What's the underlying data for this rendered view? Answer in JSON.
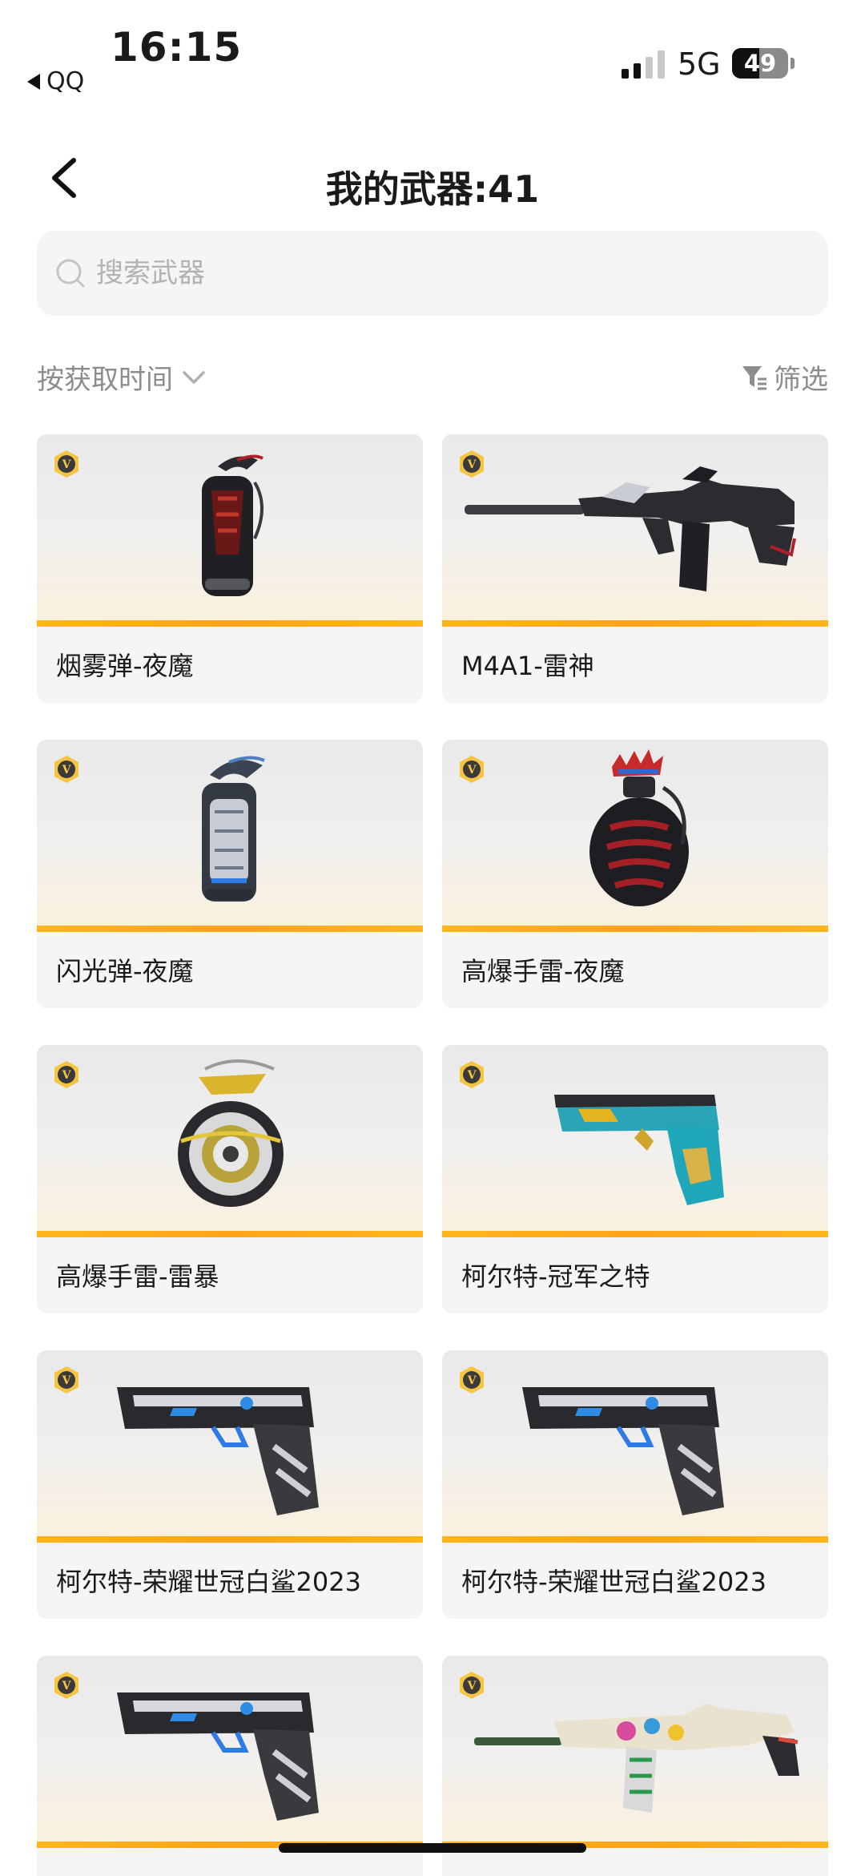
{
  "status_bar": {
    "time": "16:15",
    "back_app": "QQ",
    "network": "5G",
    "battery": "49",
    "battery_level": 0.49
  },
  "header": {
    "title": "我的武器:41"
  },
  "search": {
    "placeholder": "搜索武器",
    "value": ""
  },
  "toolbar": {
    "sort_label": "按获取时间",
    "filter_label": "筛选"
  },
  "weapons": [
    {
      "name": "烟雾弹-夜魔",
      "icon": "smoke-grenade-icon"
    },
    {
      "name": "M4A1-雷神",
      "icon": "rifle-icon"
    },
    {
      "name": "闪光弹-夜魔",
      "icon": "flash-grenade-icon"
    },
    {
      "name": "高爆手雷-夜魔",
      "icon": "frag-grenade-icon"
    },
    {
      "name": "高爆手雷-雷暴",
      "icon": "frag-grenade-icon"
    },
    {
      "name": "柯尔特-冠军之特",
      "icon": "pistol-icon"
    },
    {
      "name": "柯尔特-荣耀世冠白鲨2023",
      "icon": "pistol-icon"
    },
    {
      "name": "柯尔特-荣耀世冠白鲨2023",
      "icon": "pistol-icon"
    },
    {
      "name": "",
      "icon": "pistol-icon"
    },
    {
      "name": "",
      "icon": "rifle-icon"
    }
  ],
  "colors": {
    "accent_stripe": "#ffa31a",
    "badge_gold": "#f5c542",
    "card_bg": "#f5f5f5"
  }
}
